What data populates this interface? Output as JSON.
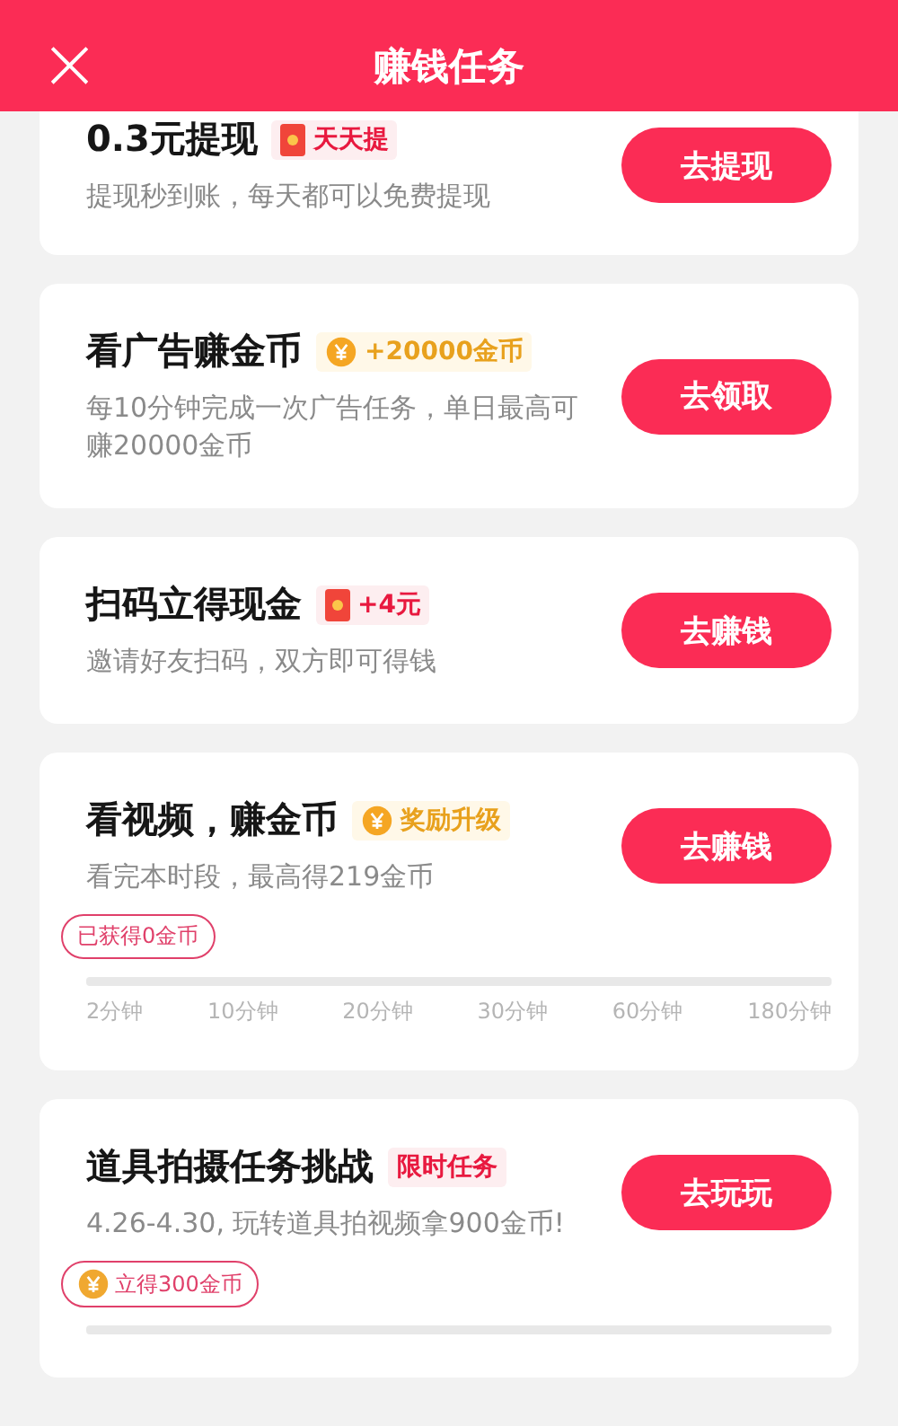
{
  "header": {
    "close": "×",
    "title": "赚钱任务"
  },
  "tasks": [
    {
      "title": "0.3元提现",
      "badge": {
        "kind": "redpacket",
        "text": "天天提"
      },
      "desc": "提现秒到账，每天都可以免费提现",
      "button": "去提现"
    },
    {
      "title": "看广告赚金币",
      "badge": {
        "kind": "coin",
        "text": "+20000金币"
      },
      "desc": "每10分钟完成一次广告任务，单日最高可赚20000金币",
      "button": "去领取"
    },
    {
      "title": "扫码立得现金",
      "badge": {
        "kind": "redpacket",
        "text": "+4元"
      },
      "desc": "邀请好友扫码，双方即可得钱",
      "button": "去赚钱"
    },
    {
      "title": "看视频，赚金币",
      "badge": {
        "kind": "coin",
        "text": "奖励升级"
      },
      "desc": "看完本时段，最高得219金币",
      "button": "去赚钱",
      "progress": {
        "bubble": {
          "kind": "plain",
          "text": "已获得0金币"
        },
        "level": 0,
        "ticks": [
          "2分钟",
          "10分钟",
          "20分钟",
          "30分钟",
          "60分钟",
          "180分钟"
        ]
      }
    },
    {
      "title": "道具拍摄任务挑战",
      "badge": {
        "kind": "plain",
        "text": "限时任务"
      },
      "desc": "4.26-4.30, 玩转道具拍视频拿900金币!",
      "button": "去玩玩",
      "progress": {
        "bubble": {
          "kind": "coin",
          "text": "立得300金币"
        },
        "level": 0
      }
    }
  ]
}
